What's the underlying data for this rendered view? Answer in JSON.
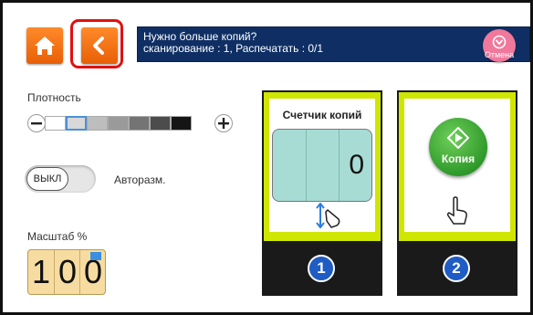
{
  "header": {
    "message_line1": "Нужно больше копий?",
    "message_line2": "сканирование : 1, Распечатать : 0/1",
    "cancel_label": "Отмена",
    "icons": [
      "home-icon",
      "back-arrow-icon",
      "cancel-icon"
    ]
  },
  "density": {
    "label": "Плотность",
    "levels": 7,
    "selected_level": 2
  },
  "auto_size": {
    "toggle_state": "ВЫКЛ",
    "label": "Авторазм."
  },
  "scale": {
    "label": "Масштаб %",
    "digits": [
      "1",
      "0",
      "0"
    ]
  },
  "steps": [
    {
      "number": "1",
      "title": "Счетчик копий",
      "counter_value": "0"
    },
    {
      "number": "2",
      "button_label": "Копия"
    }
  ],
  "colors": {
    "orange_button": "#f27a1a",
    "banner": "#0f2f64",
    "highlight": "#e21010",
    "cancel_pink": "#f0789c",
    "card_lime": "#cfe600",
    "step_number_blue": "#1f5cc4",
    "copy_green": "#2f9a2a",
    "counter_teal": "#a7dcd4",
    "scale_tan": "#f6dca0"
  }
}
